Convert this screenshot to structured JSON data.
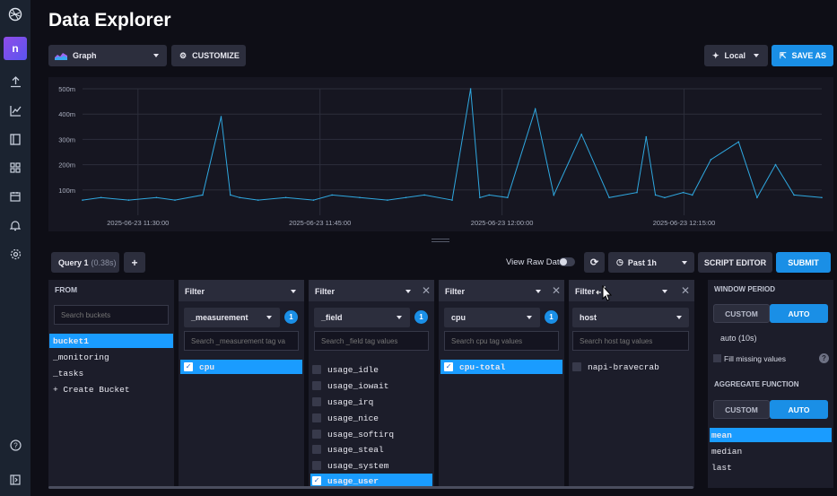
{
  "page": {
    "title": "Data Explorer"
  },
  "nav": {
    "avatar_letter": "n"
  },
  "toolbar": {
    "graph_type": "Graph",
    "customize": "CUSTOMIZE",
    "timezone": "Local",
    "save_as": "SAVE AS"
  },
  "chart_data": {
    "type": "line",
    "title": "",
    "xlabel": "",
    "ylabel": "",
    "y_ticks": [
      "500m",
      "400m",
      "300m",
      "200m",
      "100m"
    ],
    "x_ticks": [
      "2025-06-23 11:30:00",
      "2025-06-23 11:45:00",
      "2025-06-23 12:00:00",
      "2025-06-23 12:15:00"
    ],
    "ylim": [
      0,
      0.5
    ],
    "grid": true,
    "color": "#2fa8e0",
    "x_minutes": [
      0,
      2,
      5,
      8,
      10,
      13,
      15,
      16,
      17,
      19,
      22,
      25,
      27,
      30,
      33,
      35,
      37,
      40,
      42,
      43,
      44,
      46,
      49,
      51,
      54,
      57,
      60,
      61,
      62,
      63,
      65,
      66,
      68,
      71,
      73,
      75,
      77,
      80
    ],
    "values": [
      0.06,
      0.07,
      0.06,
      0.07,
      0.06,
      0.08,
      0.39,
      0.08,
      0.07,
      0.06,
      0.07,
      0.06,
      0.08,
      0.07,
      0.06,
      0.07,
      0.08,
      0.06,
      0.5,
      0.07,
      0.08,
      0.07,
      0.42,
      0.08,
      0.32,
      0.07,
      0.09,
      0.31,
      0.08,
      0.07,
      0.09,
      0.08,
      0.22,
      0.29,
      0.07,
      0.2,
      0.08,
      0.07
    ]
  },
  "query": {
    "tab_label": "Query 1",
    "tab_time": "(0.38s)",
    "add": "+",
    "view_raw": "View Raw Data",
    "time_range": "Past 1h",
    "script_editor": "SCRIPT EDITOR",
    "submit": "SUBMIT"
  },
  "from": {
    "header": "FROM",
    "search_placeholder": "Search buckets",
    "buckets": [
      "bucket1",
      "_monitoring",
      "_tasks",
      "+ Create Bucket"
    ]
  },
  "filters": [
    {
      "header": "Filter",
      "key": "_measurement",
      "count": "1",
      "search": "Search _measurement tag va",
      "items": [
        "cpu"
      ]
    },
    {
      "header": "Filter",
      "key": "_field",
      "count": "1",
      "search": "Search _field tag values",
      "items": [
        "usage_idle",
        "usage_iowait",
        "usage_irq",
        "usage_nice",
        "usage_softirq",
        "usage_steal",
        "usage_system",
        "usage_user"
      ]
    },
    {
      "header": "Filter",
      "key": "cpu",
      "count": "1",
      "search": "Search cpu tag values",
      "items": [
        "cpu-total"
      ]
    },
    {
      "header": "Filter",
      "key": "host",
      "search": "Search host tag values",
      "items": [
        "napi-bravecrab"
      ]
    }
  ],
  "window": {
    "period_label": "WINDOW PERIOD",
    "custom": "CUSTOM",
    "auto": "AUTO",
    "auto_value": "auto (10s)",
    "fill_missing": "Fill missing values",
    "help": "?",
    "aggregate_label": "AGGREGATE FUNCTION",
    "functions": [
      "mean",
      "median",
      "last"
    ]
  }
}
